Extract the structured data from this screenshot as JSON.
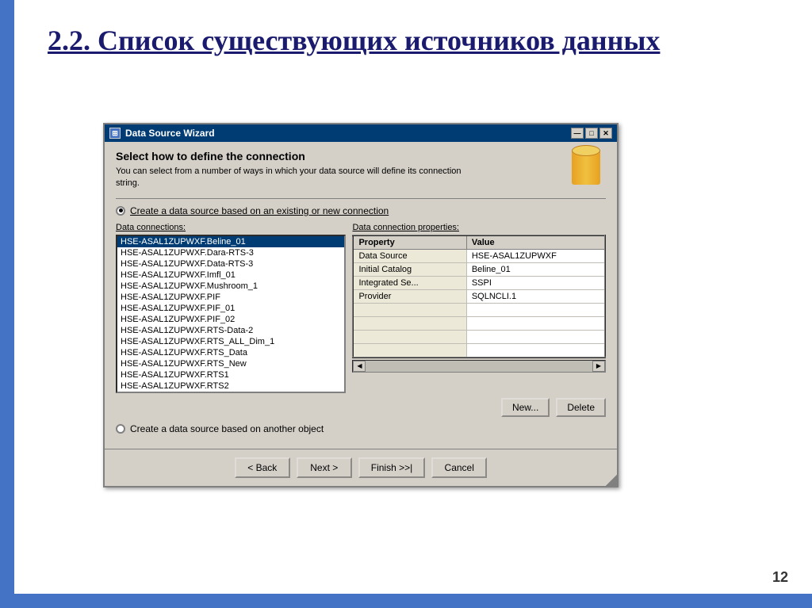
{
  "slide": {
    "title": "2.2. Список существующих источников данных",
    "page_number": "12"
  },
  "dialog": {
    "title": "Data Source Wizard",
    "header": {
      "heading": "Select how to define the connection",
      "description": "You can select from a number of ways in which your data source will define its connection string."
    },
    "window_controls": {
      "minimize": "—",
      "maximize": "□",
      "close": "✕"
    },
    "radio_option1": "Create a data source based on an existing or new connection",
    "radio_option2": "Create a data source based on another object",
    "data_connections_label": "Data connections:",
    "data_connection_properties_label": "Data connection properties:",
    "connections": [
      "HSE-ASAL1ZUPWXF.Beline_01",
      "HSE-ASAL1ZUPWXF.Dara-RTS-3",
      "HSE-ASAL1ZUPWXF.Data-RTS-3",
      "HSE-ASAL1ZUPWXF.Imfl_01",
      "HSE-ASAL1ZUPWXF.Mushroom_1",
      "HSE-ASAL1ZUPWXF.PIF",
      "HSE-ASAL1ZUPWXF.PIF_01",
      "HSE-ASAL1ZUPWXF.PIF_02",
      "HSE-ASAL1ZUPWXF.RTS-Data-2",
      "HSE-ASAL1ZUPWXF.RTS_ALL_Dim_1",
      "HSE-ASAL1ZUPWXF.RTS_Data",
      "HSE-ASAL1ZUPWXF.RTS_New",
      "HSE-ASAL1ZUPWXF.RTS1",
      "HSE-ASAL1ZUPWXF.RTS2"
    ],
    "selected_connection_index": 0,
    "properties": {
      "headers": [
        "Property",
        "Value"
      ],
      "rows": [
        [
          "Data Source",
          "HSE-ASAL1ZUPWXF"
        ],
        [
          "Initial Catalog",
          "Beline_01"
        ],
        [
          "Integrated Se...",
          "SSPI"
        ],
        [
          "Provider",
          "SQLNCLI.1"
        ]
      ]
    },
    "buttons": {
      "new": "New...",
      "delete": "Delete"
    },
    "footer": {
      "back": "< Back",
      "next": "Next >",
      "finish": "Finish >>|",
      "cancel": "Cancel"
    }
  }
}
